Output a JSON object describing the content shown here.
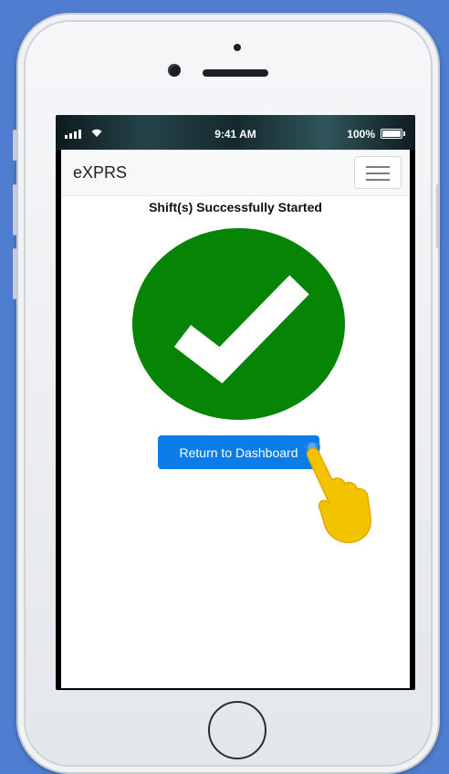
{
  "status_bar": {
    "time": "9:41 AM",
    "battery": "100%"
  },
  "app": {
    "brand": "eXPRS",
    "menu_icon": "hamburger-menu-icon",
    "heading": "Shift(s) Successfully Started",
    "success_icon": "checkmark-icon",
    "success_color": "#058406",
    "return_button_label": "Return to Dashboard",
    "button_color": "#0a7de8"
  },
  "overlay": {
    "hand_icon": "pointing-hand-icon"
  }
}
